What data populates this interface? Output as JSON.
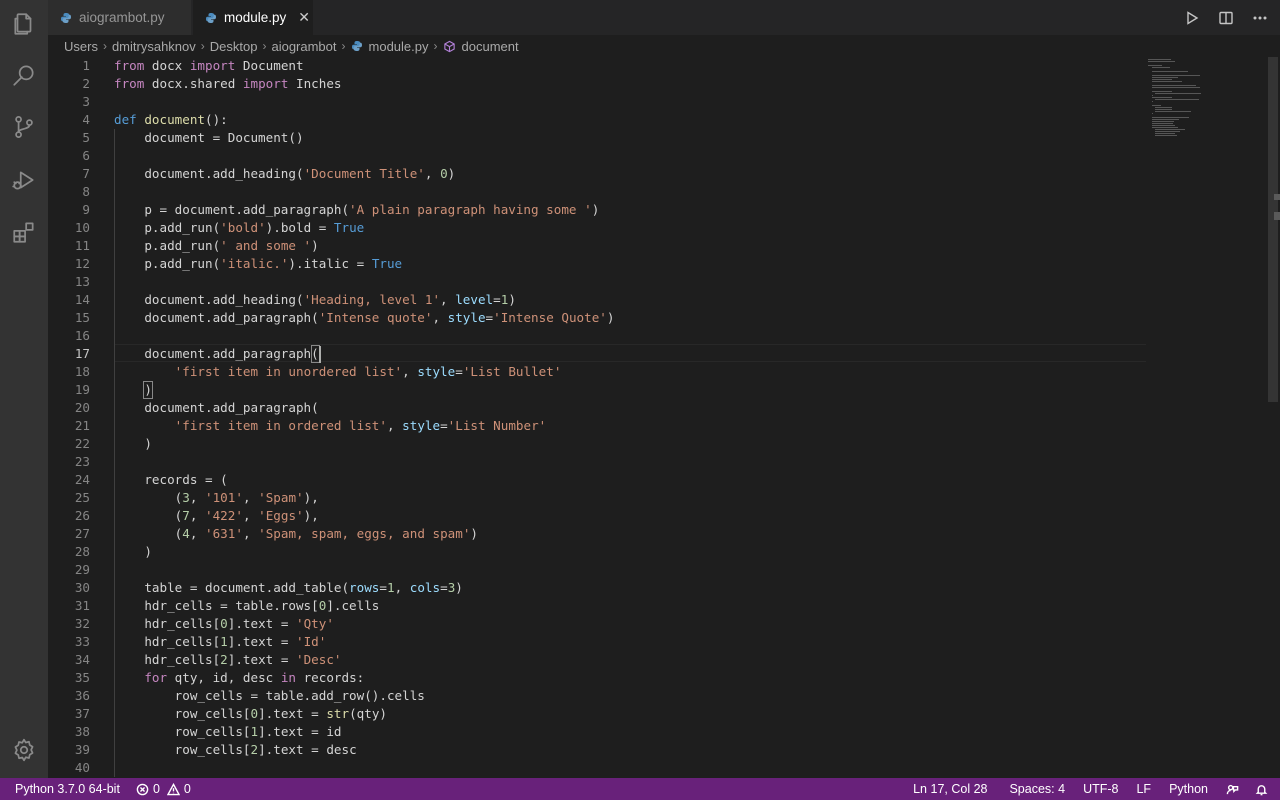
{
  "tabs": [
    {
      "label": "aiogrambot.py",
      "icon": "python-icon",
      "active": false
    },
    {
      "label": "module.py",
      "icon": "python-icon",
      "active": true,
      "close": "✕"
    }
  ],
  "title_actions": [
    "run-icon",
    "split-editor-icon",
    "more-actions-icon"
  ],
  "breadcrumb": {
    "items": [
      "Users",
      "dmitrysahknov",
      "Desktop",
      "aiogrambot",
      "module.py",
      "document"
    ],
    "separator": "›"
  },
  "editor": {
    "current_line": 17,
    "lines": [
      "from docx import Document",
      "from docx.shared import Inches",
      "",
      "def document():",
      "    document = Document()",
      "",
      "    document.add_heading('Document Title', 0)",
      "",
      "    p = document.add_paragraph('A plain paragraph having some ')",
      "    p.add_run('bold').bold = True",
      "    p.add_run(' and some ')",
      "    p.add_run('italic.').italic = True",
      "",
      "    document.add_heading('Heading, level 1', level=1)",
      "    document.add_paragraph('Intense quote', style='Intense Quote')",
      "",
      "    document.add_paragraph(",
      "        'first item in unordered list', style='List Bullet'",
      "    )",
      "    document.add_paragraph(",
      "        'first item in ordered list', style='List Number'",
      "    )",
      "",
      "    records = (",
      "        (3, '101', 'Spam'),",
      "        (7, '422', 'Eggs'),",
      "        (4, '631', 'Spam, spam, eggs, and spam')",
      "    )",
      "",
      "    table = document.add_table(rows=1, cols=3)",
      "    hdr_cells = table.rows[0].cells",
      "    hdr_cells[0].text = 'Qty'",
      "    hdr_cells[1].text = 'Id'",
      "    hdr_cells[2].text = 'Desc'",
      "    for qty, id, desc in records:",
      "        row_cells = table.add_row().cells",
      "        row_cells[0].text = str(qty)",
      "        row_cells[1].text = id",
      "        row_cells[2].text = desc",
      ""
    ]
  },
  "status_bar": {
    "interpreter": "Python 3.7.0 64-bit",
    "errors": "0",
    "warnings": "0",
    "position": "Ln 17, Col 28",
    "indent": "Spaces: 4",
    "encoding": "UTF-8",
    "eol": "LF",
    "language": "Python",
    "color": "#68217a"
  },
  "activity_bar": [
    "explorer-icon",
    "search-icon",
    "source-control-icon",
    "run-debug-icon",
    "extensions-icon",
    "settings-gear-icon"
  ]
}
